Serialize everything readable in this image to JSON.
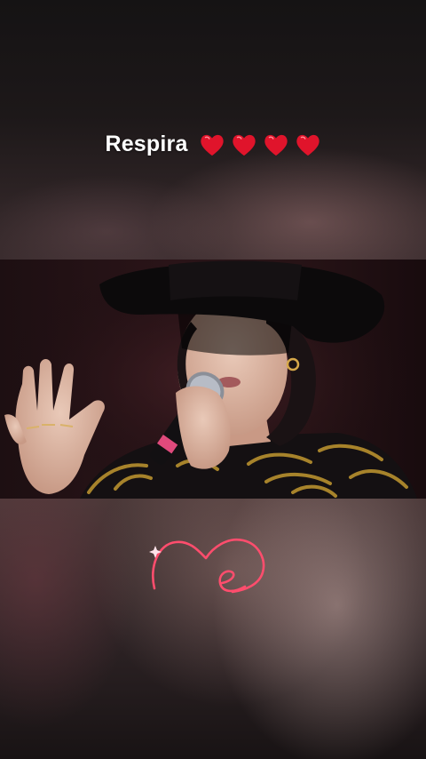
{
  "caption": {
    "text": "Respira",
    "emoji": [
      "red-heart",
      "red-heart",
      "red-heart",
      "red-heart"
    ],
    "heart_color": "#e0142b"
  },
  "signature": {
    "color": "#ff4d6d"
  }
}
